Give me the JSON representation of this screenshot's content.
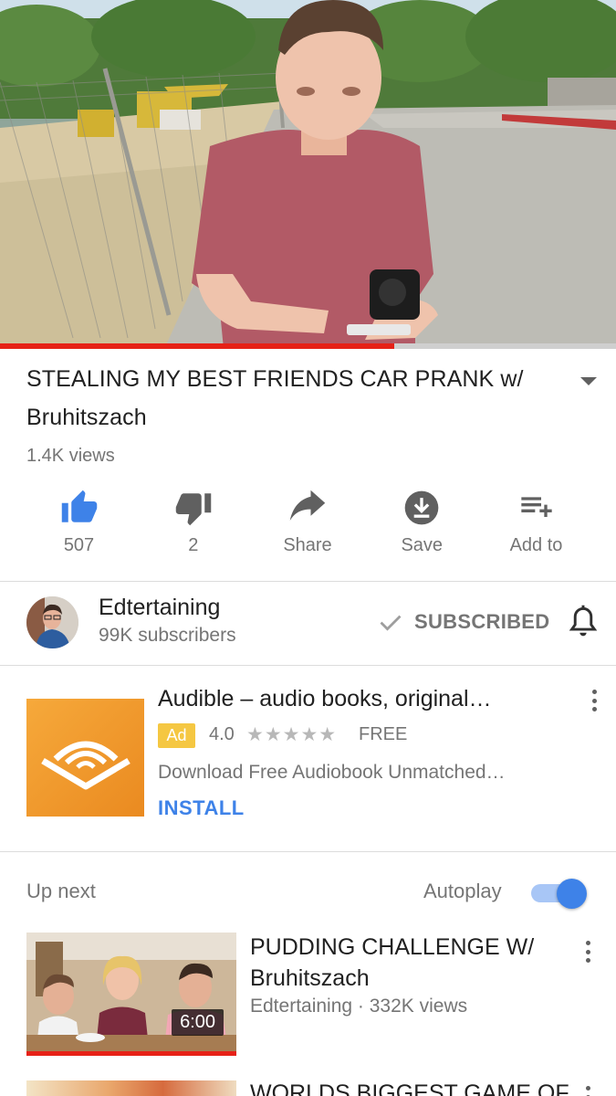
{
  "video": {
    "progress_percent": 64,
    "title": "STEALING MY BEST FRIENDS CAR PRANK w/ Bruhitszach",
    "views": "1.4K views",
    "expand_icon": "chevron-down-icon"
  },
  "actions": [
    {
      "icon": "thumbs-up-icon",
      "label": "507",
      "active_color": "#3e82e8"
    },
    {
      "icon": "thumbs-down-icon",
      "label": "2"
    },
    {
      "icon": "share-icon",
      "label": "Share"
    },
    {
      "icon": "download-icon",
      "label": "Save"
    },
    {
      "icon": "add-to-playlist-icon",
      "label": "Add to"
    }
  ],
  "channel": {
    "name": "Edtertaining",
    "subscribers": "99K subscribers",
    "subscribe_label": "SUBSCRIBED",
    "bell_icon": "bell-icon"
  },
  "ad": {
    "title": "Audible – audio books, original…",
    "badge": "Ad",
    "rating": "4.0",
    "stars": "★★★★★",
    "price": "FREE",
    "description": "Download Free Audiobook Unmatched…",
    "install_label": "INSTALL",
    "badge_color": "#f5c742",
    "install_color": "#3e82e8"
  },
  "up_next": {
    "heading": "Up next",
    "autoplay_label": "Autoplay",
    "autoplay_on": true,
    "videos": [
      {
        "title": "PUDDING CHALLENGE W/ Bruhitszach",
        "meta": "Edtertaining · 332K views",
        "duration": "6:00"
      },
      {
        "title": "WORLDS BIGGEST GAME OF"
      }
    ]
  },
  "colors": {
    "accent_blue": "#3e82e8",
    "progress_red": "#e62117",
    "secondary_text": "#757575"
  }
}
